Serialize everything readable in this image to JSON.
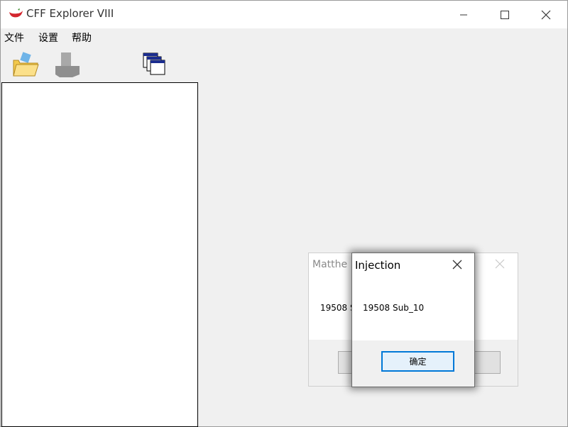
{
  "window": {
    "title": "CFF Explorer VIII"
  },
  "menu": {
    "items": [
      "文件",
      "设置",
      "帮助"
    ]
  },
  "toolbar": {
    "icons": [
      "open-folder-icon",
      "pe-icon",
      "windows-cascade-icon"
    ]
  },
  "background_dialog": {
    "title": "Matthe",
    "message": "19508 S"
  },
  "dialog": {
    "title": "Injection",
    "message": "19508  Sub_10",
    "ok_label": "确定"
  },
  "colors": {
    "accent": "#0078d7",
    "titlebar": "#ffffff",
    "background": "#f0f0f0"
  }
}
